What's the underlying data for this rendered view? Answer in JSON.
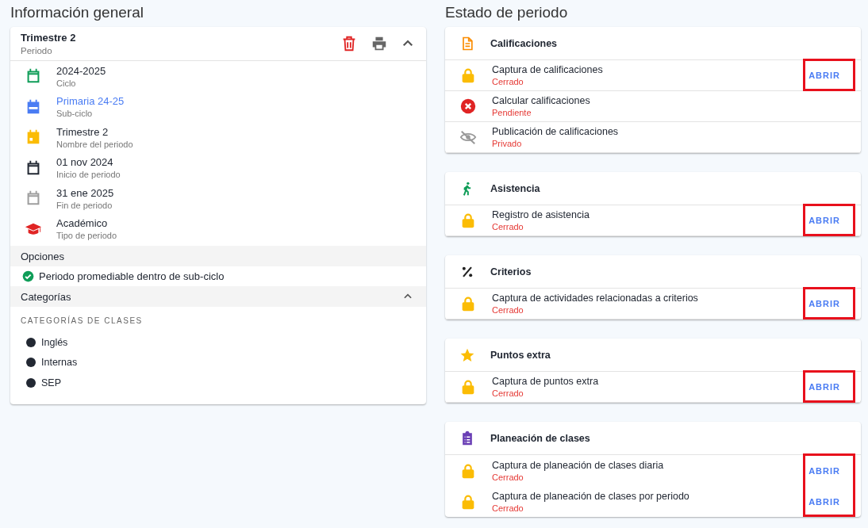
{
  "left": {
    "title": "Información general",
    "period": {
      "name": "Trimestre 2",
      "label": "Periodo"
    },
    "info": [
      {
        "kind": "calendar-outline",
        "color": "#0f9d58",
        "value": "2024-2025",
        "label": "Ciclo",
        "link": false
      },
      {
        "kind": "calendar-filled",
        "color": "#4a7cf3",
        "value": "Primaria 24-25",
        "label": "Sub-ciclo",
        "link": true
      },
      {
        "kind": "calendar-dot",
        "color": "#fbbc04",
        "value": "Trimestre 2",
        "label": "Nombre del periodo",
        "link": false
      },
      {
        "kind": "calendar-outline",
        "color": "#222833",
        "value": "01 nov 2024",
        "label": "Inicio de periodo",
        "link": false
      },
      {
        "kind": "calendar-outline",
        "color": "#9e9e9e",
        "value": "31 ene 2025",
        "label": "Fin de periodo",
        "link": false
      },
      {
        "kind": "cap",
        "color": "#e02424",
        "value": "Académico",
        "label": "Tipo de periodo",
        "link": false
      }
    ],
    "options_title": "Opciones",
    "options": [
      {
        "label": "Periodo promediable dentro de sub-ciclo",
        "checked": true
      }
    ],
    "categories_title": "Categorías",
    "categories_expanded": true,
    "categories_subtitle": "CATEGORÍAS DE CLASES",
    "categories": [
      {
        "name": "Inglés",
        "color": "#222833"
      },
      {
        "name": "Internas",
        "color": "#222833"
      },
      {
        "name": "SEP",
        "color": "#222833"
      }
    ]
  },
  "right": {
    "title": "Estado de periodo",
    "sections": [
      {
        "kind": "document",
        "title": "Calificaciones",
        "actions_highlighted": true,
        "rows": [
          {
            "kind": "lock",
            "name": "Captura de calificaciones",
            "status": "Cerrado",
            "action": "ABRIR"
          },
          {
            "kind": "error",
            "name": "Calcular calificaciones",
            "status": "Pendiente"
          },
          {
            "kind": "hidden",
            "name": "Publicación de calificaciones",
            "status": "Privado"
          }
        ]
      },
      {
        "kind": "walk",
        "title": "Asistencia",
        "actions_highlighted": true,
        "rows": [
          {
            "kind": "lock",
            "name": "Registro de asistencia",
            "status": "Cerrado",
            "action": "ABRIR"
          }
        ]
      },
      {
        "kind": "percent",
        "title": "Criterios",
        "actions_highlighted": true,
        "rows": [
          {
            "kind": "lock",
            "name": "Captura de actividades relacionadas a criterios",
            "status": "Cerrado",
            "action": "ABRIR"
          }
        ]
      },
      {
        "kind": "star",
        "title": "Puntos extra",
        "actions_highlighted": true,
        "rows": [
          {
            "kind": "lock",
            "name": "Captura de puntos extra",
            "status": "Cerrado",
            "action": "ABRIR"
          }
        ]
      },
      {
        "kind": "clipboard",
        "title": "Planeación de clases",
        "actions_highlighted": true,
        "rows": [
          {
            "kind": "lock",
            "name": "Captura de planeación de clases diaria",
            "status": "Cerrado",
            "action": "ABRIR"
          },
          {
            "kind": "lock",
            "name": "Captura de planeación de clases por periodo",
            "status": "Cerrado",
            "action": "ABRIR"
          }
        ]
      }
    ]
  }
}
